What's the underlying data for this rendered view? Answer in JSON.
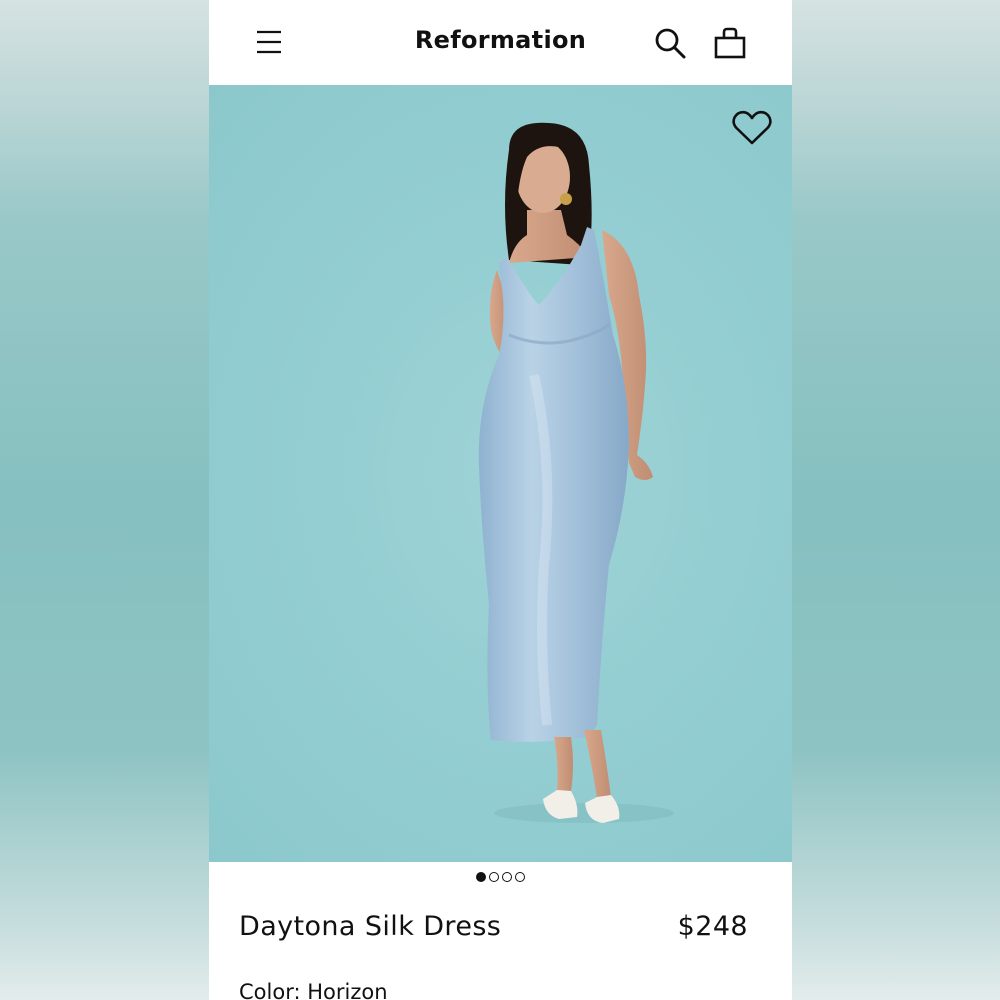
{
  "header": {
    "brand": "Reformation",
    "icons": [
      "menu-icon",
      "search-icon",
      "shopping-bag-icon"
    ]
  },
  "hero": {
    "favorite_icon": "heart-icon",
    "carousel": {
      "count": 4,
      "active_index": 0
    }
  },
  "product": {
    "name": "Daytona Silk Dress",
    "price": "$248",
    "color_label": "Color:",
    "color_value": "Horizon"
  },
  "colors": {
    "backdrop": "#94ced2",
    "dress": "#a9c6de",
    "text": "#111111"
  }
}
